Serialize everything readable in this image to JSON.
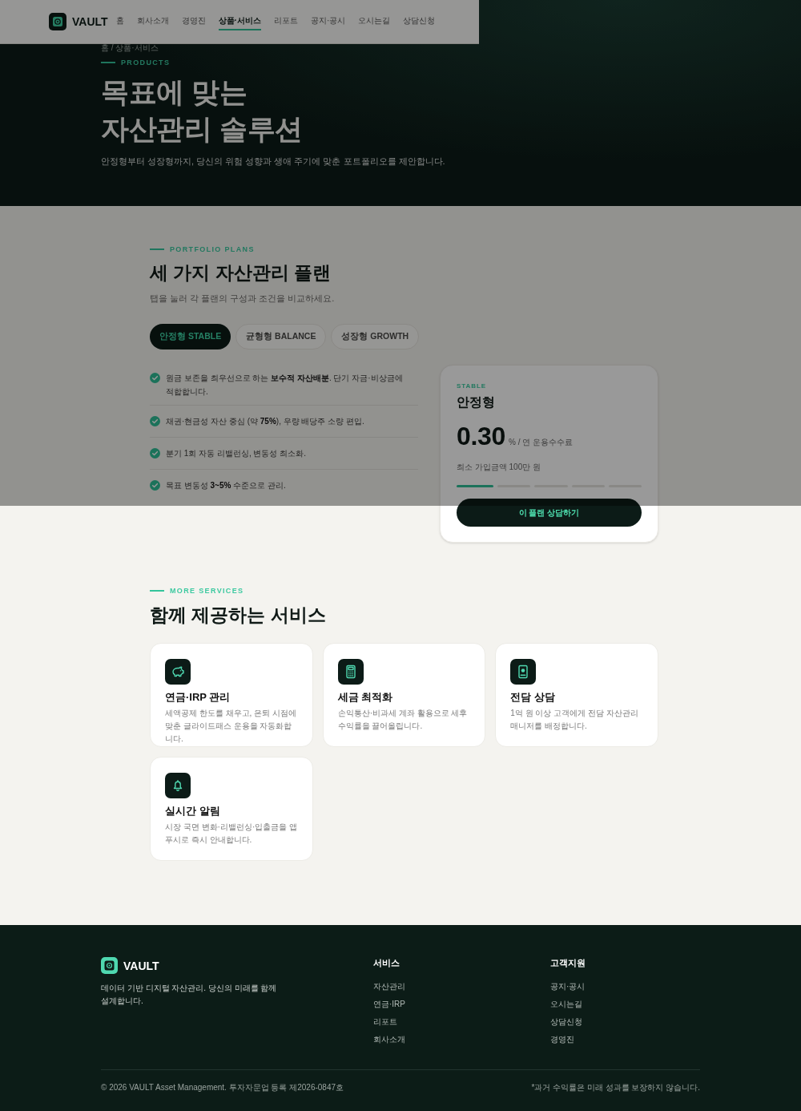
{
  "screen_dimmed": true,
  "header": {
    "brand": "VAULT",
    "nav": [
      {
        "label": "홈",
        "selected": false
      },
      {
        "label": "회사소개",
        "selected": false
      },
      {
        "label": "경영진",
        "selected": false
      },
      {
        "label": "상품·서비스",
        "selected": true
      },
      {
        "label": "리포트",
        "selected": false
      },
      {
        "label": "공지·공시",
        "selected": false
      },
      {
        "label": "오시는길",
        "selected": false
      },
      {
        "label": "상담신청",
        "selected": false
      }
    ]
  },
  "hero": {
    "breadcrumb": "홈 / 상품·서비스",
    "eyebrow": "PRODUCTS",
    "title_lines": [
      "목표에 맞는",
      "자산관리 솔루션"
    ],
    "subtitle": "안정형부터 성장형까지, 당신의 위험 성향과 생애 주기에 맞춘 포트폴리오를 제안합니다."
  },
  "plans": {
    "eyebrow": "PORTFOLIO PLANS",
    "title": "세 가지 자산관리 플랜",
    "subtitle": "탭을 눌러 각 플랜의 구성과 조건을 비교하세요.",
    "tabs": [
      {
        "label": "안정형 STABLE",
        "selected": true
      },
      {
        "label": "균형형 BALANCE",
        "selected": false
      },
      {
        "label": "성장형 GROWTH",
        "selected": false
      }
    ],
    "features": [
      "원금 보존을 최우선으로 하는 **보수적 자산배분**. 단기 자금·비상금에 적합합니다.",
      "채권·현금성 자산 중심 (약 **75%**), 우량 배당주 소량 편입.",
      "분기 1회 자동 리밸런싱, 변동성 최소화.",
      "목표 변동성 **3~5%** 수준으로 관리."
    ],
    "card": {
      "eyebrow": "STABLE",
      "name": "안정형",
      "fee": "0.30",
      "fee_unit": "% / 연 운용수수료",
      "minimum": "최소 가입금액 100만 원",
      "risk_meter": {
        "level": 0.2
      },
      "button": "이 플랜 상담하기"
    }
  },
  "services": {
    "eyebrow": "MORE SERVICES",
    "title": "함께 제공하는 서비스",
    "cards": [
      {
        "title": "연금·IRP 관리",
        "description": "세액공제 한도를 채우고, 은퇴 시점에 맞춘 글라이드패스 운용을 자동화합니다."
      },
      {
        "title": "세금 최적화",
        "description": "손익통산·비과세 계좌 활용으로 세후 수익률을 끌어올립니다."
      },
      {
        "title": "전담 상담",
        "description": "1억 원 이상 고객에게 전담 자산관리 매니저를 배정합니다."
      },
      {
        "title": "실시간 알림",
        "description": "시장 국면 변화·리밸런싱·입출금을 앱 푸시로 즉시 안내합니다."
      }
    ]
  },
  "footer": {
    "brand": "VAULT",
    "description": "데이터 기반 디지털 자산관리. 당신의 미래를 함께 설계합니다.",
    "columns": [
      {
        "title": "서비스",
        "links": [
          "자산관리",
          "연금·IRP",
          "리포트",
          "회사소개"
        ]
      },
      {
        "title": "고객지원",
        "links": [
          "공지·공시",
          "오시는길",
          "상담신청",
          "경영진"
        ]
      }
    ],
    "copyright": "© 2026 VAULT Asset Management. 투자자문업 등록 제2026-0847호",
    "disclaimer": "*과거 수익률은 미래 성과를 보장하지 않습니다."
  }
}
